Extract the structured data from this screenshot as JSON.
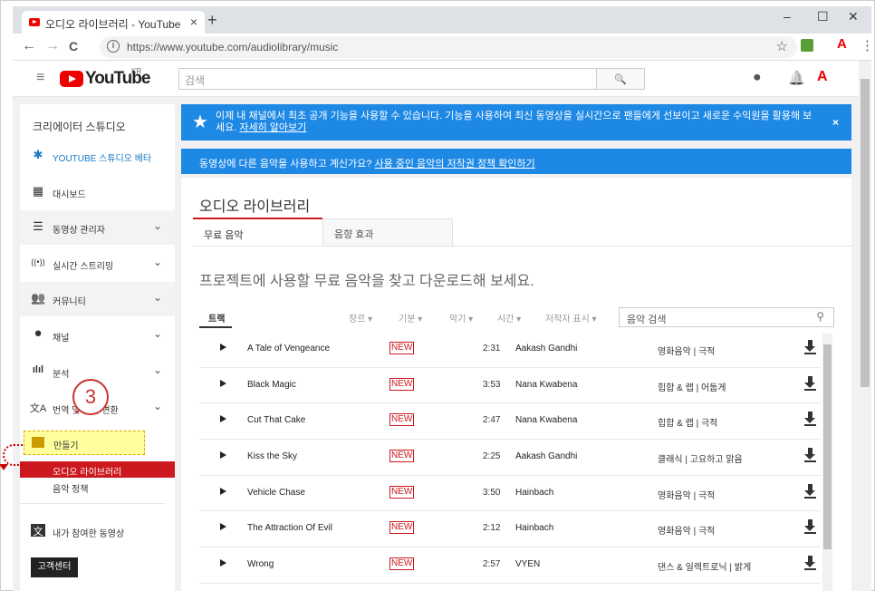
{
  "browser": {
    "tab_title": "오디오 라이브러리 - YouTube",
    "tab_close": "×",
    "new_tab": "+",
    "url": "https://www.youtube.com/audiolibrary/music",
    "win_min": "–",
    "win_max": "☐",
    "win_close": "✕",
    "nav_back": "←",
    "nav_forward": "→",
    "nav_reload": "C",
    "info": "i",
    "star": "☆",
    "ext_letter": "A",
    "menu": "⋮"
  },
  "youtube_header": {
    "burger": "≡",
    "logo_text": "YouTube",
    "logo_region": "KR",
    "search_placeholder": "검색",
    "search_icon": "🔍",
    "upload_icon": "⏺",
    "bell_icon": "🔔",
    "avatar_letter": "A"
  },
  "sidebar": {
    "title": "크리에이터 스튜디오",
    "items": [
      {
        "label": "YOUTUBE 스튜디오 베타",
        "icon": "gear-icon",
        "glyph": "✱"
      },
      {
        "label": "대시보드",
        "icon": "dashboard-icon",
        "glyph": "▦"
      },
      {
        "label": "동영상 관리자",
        "icon": "video-manager-icon",
        "glyph": "☰",
        "chevron": "⌄"
      },
      {
        "label": "실시간 스트리밍",
        "icon": "live-icon",
        "glyph": "((•))",
        "chevron": "⌄"
      },
      {
        "label": "커뮤니티",
        "icon": "community-icon",
        "glyph": "👥",
        "chevron": "⌄"
      },
      {
        "label": "채널",
        "icon": "channel-icon",
        "glyph": "●",
        "chevron": "⌄"
      },
      {
        "label": "분석",
        "icon": "analytics-icon",
        "glyph": "ılıl",
        "chevron": "⌄"
      },
      {
        "label": "번역 및 자막 변환",
        "icon": "translate-icon",
        "glyph": "文A",
        "chevron": "⌄"
      }
    ],
    "make": "만들기",
    "sub_active": "오디오 라이브러리",
    "sub2": "음악 정책",
    "contributed": "내가 참여한 동영상",
    "help": "고객센터"
  },
  "annotation": {
    "callout_number": "3"
  },
  "banner1": {
    "text": "이제 내 채널에서 최초 공개 기능을 사용할 수 있습니다. 기능을 사용하여 최신 동영상을 실시간으로 팬들에게 선보이고 새로운 수익원을 활용해 보세요.",
    "link": "자세히 알아보기",
    "close": "×"
  },
  "banner2": {
    "text": "동영상에 다른 음악을 사용하고 계신가요?",
    "link": "사용 중인 음악의 저작권 정책 확인하기"
  },
  "library": {
    "title": "오디오 라이브러리",
    "tab_free": "무료 음악",
    "tab_sfx": "음향 효과",
    "headline": "프로젝트에 사용할 무료 음악을 찾고 다운로드해 보세요.",
    "columns": {
      "track": "트랙",
      "genre": "장르 ▾",
      "mood": "기분 ▾",
      "instrument": "악기 ▾",
      "duration": "시간 ▾",
      "attribution": "저작자 표시 ▾"
    },
    "search_placeholder": "음악 검색",
    "new_badge": "NEW",
    "tracks": [
      {
        "title": "A Tale of Vengeance",
        "duration": "2:31",
        "artist": "Aakash Gandhi",
        "genre": "영화음악 | 극적"
      },
      {
        "title": "Black Magic",
        "duration": "3:53",
        "artist": "Nana Kwabena",
        "genre": "힙합 & 랩 | 어둡게"
      },
      {
        "title": "Cut That Cake",
        "duration": "2:47",
        "artist": "Nana Kwabena",
        "genre": "힙합 & 랩 | 극적"
      },
      {
        "title": "Kiss the Sky",
        "duration": "2:25",
        "artist": "Aakash Gandhi",
        "genre": "클래식 | 고요하고 맑음"
      },
      {
        "title": "Vehicle Chase",
        "duration": "3:50",
        "artist": "Hainbach",
        "genre": "영화음악 | 극적"
      },
      {
        "title": "The Attraction Of Evil",
        "duration": "2:12",
        "artist": "Hainbach",
        "genre": "영화음악 | 극적"
      },
      {
        "title": "Wrong",
        "duration": "2:57",
        "artist": "VYEN",
        "genre": "댄스 & 일렉트로닉 | 밝게"
      }
    ]
  },
  "colors": {
    "youtube_red": "#cc181e",
    "banner_blue": "#1e88e5",
    "highlight_yellow": "#ffff9e"
  }
}
